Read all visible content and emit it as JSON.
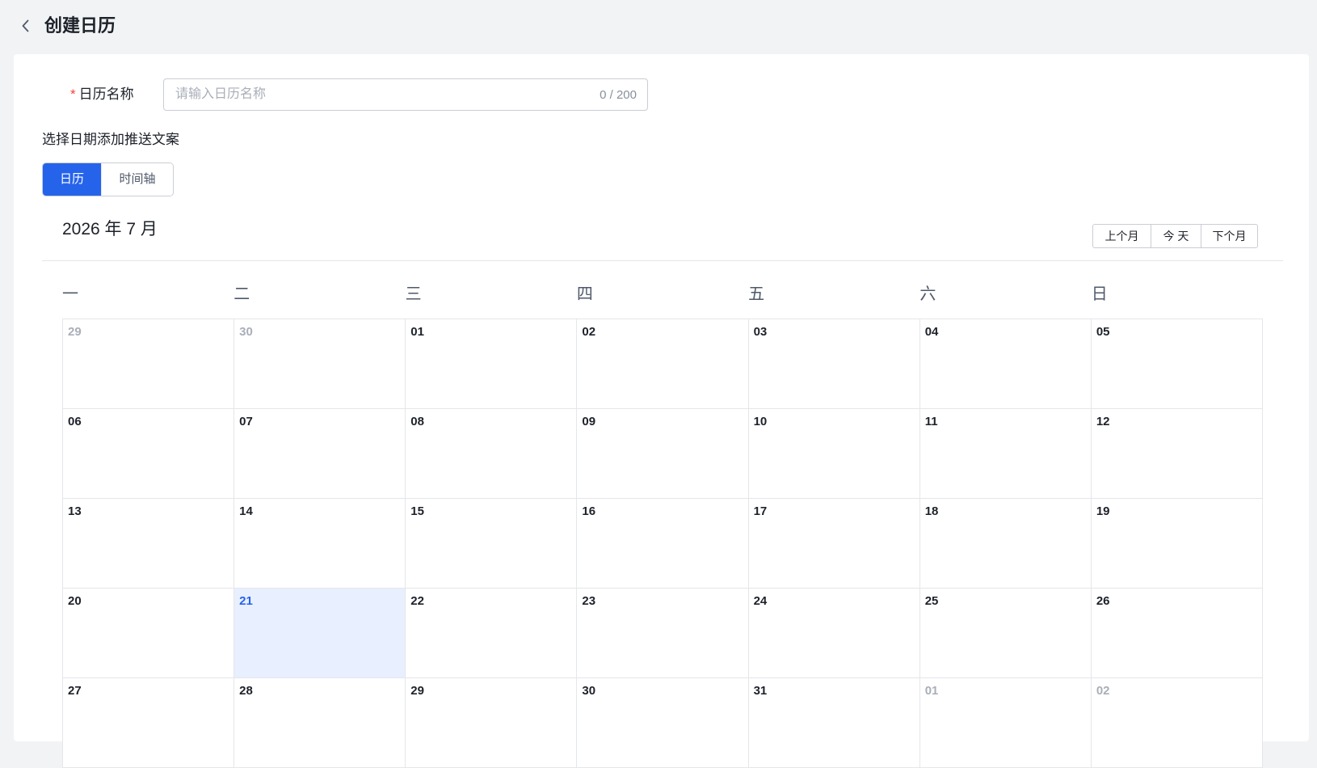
{
  "header": {
    "title": "创建日历",
    "back_icon": "chevron-left-icon"
  },
  "form": {
    "name_label": "日历名称",
    "required_mark": "*",
    "name_placeholder": "请输入日历名称",
    "name_value": "",
    "char_count": "0 / 200"
  },
  "section": {
    "label": "选择日期添加推送文案"
  },
  "view_toggle": {
    "calendar_label": "日历",
    "timeline_label": "时间轴",
    "active": "日历"
  },
  "calendar": {
    "month_title": "2026 年 7 月",
    "prev_month_label": "上个月",
    "today_label": "今 天",
    "next_month_label": "下个月",
    "weekdays": [
      "一",
      "二",
      "三",
      "四",
      "五",
      "六",
      "日"
    ],
    "days": [
      {
        "label": "29",
        "in_month": false,
        "today": false
      },
      {
        "label": "30",
        "in_month": false,
        "today": false
      },
      {
        "label": "01",
        "in_month": true,
        "today": false
      },
      {
        "label": "02",
        "in_month": true,
        "today": false
      },
      {
        "label": "03",
        "in_month": true,
        "today": false
      },
      {
        "label": "04",
        "in_month": true,
        "today": false
      },
      {
        "label": "05",
        "in_month": true,
        "today": false
      },
      {
        "label": "06",
        "in_month": true,
        "today": false
      },
      {
        "label": "07",
        "in_month": true,
        "today": false
      },
      {
        "label": "08",
        "in_month": true,
        "today": false
      },
      {
        "label": "09",
        "in_month": true,
        "today": false
      },
      {
        "label": "10",
        "in_month": true,
        "today": false
      },
      {
        "label": "11",
        "in_month": true,
        "today": false
      },
      {
        "label": "12",
        "in_month": true,
        "today": false
      },
      {
        "label": "13",
        "in_month": true,
        "today": false
      },
      {
        "label": "14",
        "in_month": true,
        "today": false
      },
      {
        "label": "15",
        "in_month": true,
        "today": false
      },
      {
        "label": "16",
        "in_month": true,
        "today": false
      },
      {
        "label": "17",
        "in_month": true,
        "today": false
      },
      {
        "label": "18",
        "in_month": true,
        "today": false
      },
      {
        "label": "19",
        "in_month": true,
        "today": false
      },
      {
        "label": "20",
        "in_month": true,
        "today": false
      },
      {
        "label": "21",
        "in_month": true,
        "today": true
      },
      {
        "label": "22",
        "in_month": true,
        "today": false
      },
      {
        "label": "23",
        "in_month": true,
        "today": false
      },
      {
        "label": "24",
        "in_month": true,
        "today": false
      },
      {
        "label": "25",
        "in_month": true,
        "today": false
      },
      {
        "label": "26",
        "in_month": true,
        "today": false
      },
      {
        "label": "27",
        "in_month": true,
        "today": false
      },
      {
        "label": "28",
        "in_month": true,
        "today": false
      },
      {
        "label": "29",
        "in_month": true,
        "today": false
      },
      {
        "label": "30",
        "in_month": true,
        "today": false
      },
      {
        "label": "31",
        "in_month": true,
        "today": false
      },
      {
        "label": "01",
        "in_month": false,
        "today": false
      },
      {
        "label": "02",
        "in_month": false,
        "today": false
      }
    ]
  },
  "colors": {
    "primary": "#2563eb",
    "today_bg": "#e8efff",
    "required": "#f53f3f",
    "muted_text": "#a9aeb8",
    "page_bg": "#f2f3f5"
  }
}
